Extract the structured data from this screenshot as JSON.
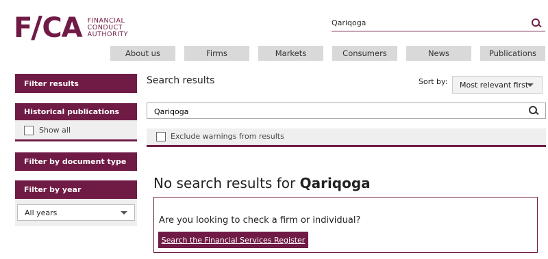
{
  "logo": {
    "mark": "FCA",
    "line1": "FINANCIAL",
    "line2": "CONDUCT",
    "line3": "AUTHORITY"
  },
  "header_search": {
    "value": "Qariqoga",
    "icon": "search-icon"
  },
  "nav": [
    {
      "label": "About us"
    },
    {
      "label": "Firms"
    },
    {
      "label": "Markets"
    },
    {
      "label": "Consumers"
    },
    {
      "label": "News"
    },
    {
      "label": "Publications"
    }
  ],
  "sidebar": {
    "filter_results": "Filter results",
    "historical": "Historical publications",
    "show_all": "Show all",
    "doc_type": "Filter by document type",
    "by_year": "Filter by year",
    "year_selected": "All years"
  },
  "main": {
    "title": "Search results",
    "sort_label": "Sort by:",
    "sort_selected": "Most relevant first",
    "search_value": "Qariqoga",
    "exclude_label": "Exclude warnings from results",
    "no_results_prefix": "No search results for",
    "no_results_term": "Qariqoga",
    "firm_question": "Are you looking to check a firm or individual?",
    "register_button": "Search the Financial Services Register"
  },
  "colors": {
    "brand": "#701b45",
    "nav_bg": "#d9d9d9",
    "panel_bg": "#efefef"
  }
}
